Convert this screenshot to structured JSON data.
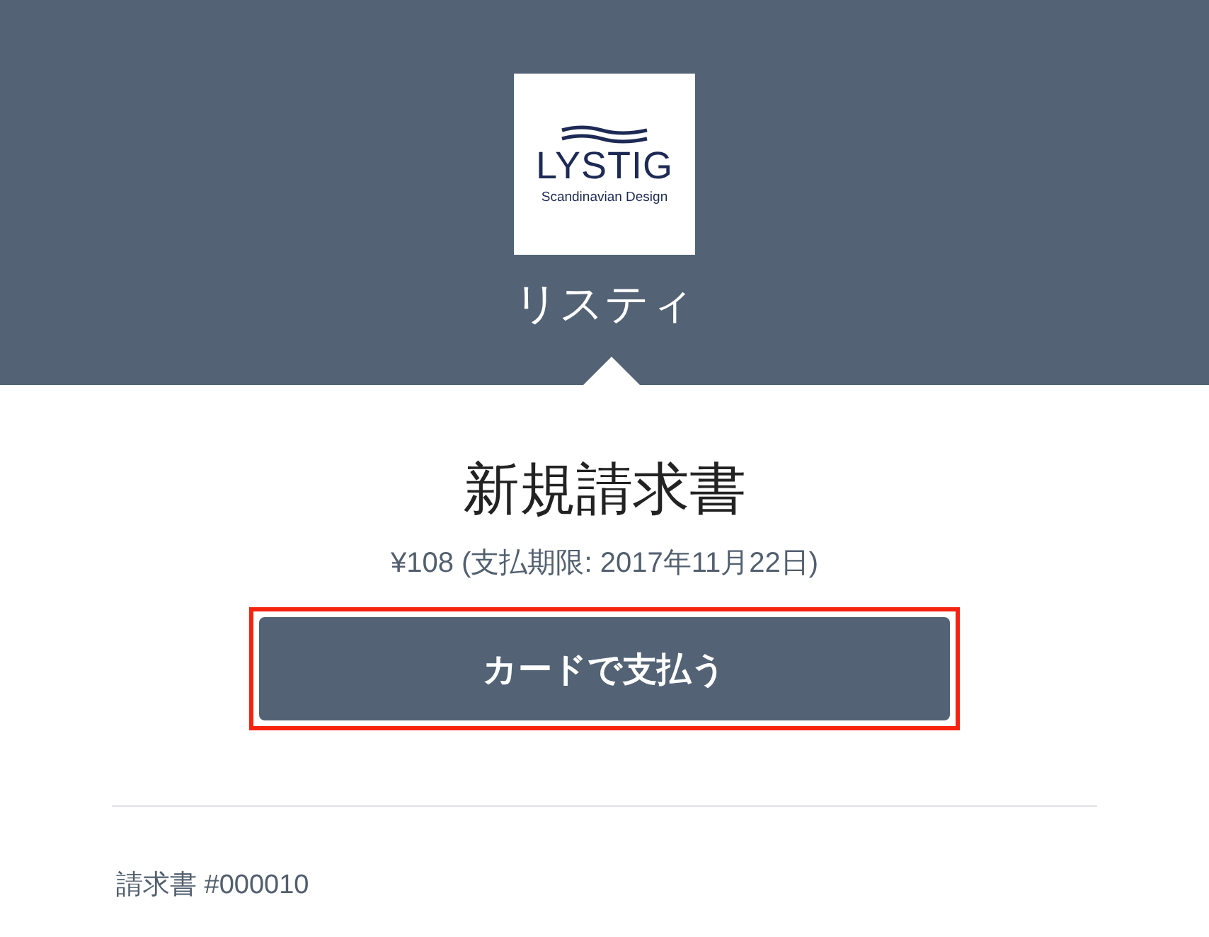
{
  "header": {
    "logo": {
      "brand": "LYSTIG",
      "tagline": "Scandinavian Design"
    },
    "store_name": "リスティ"
  },
  "invoice": {
    "title": "新規請求書",
    "amount_due": "¥108 (支払期限: 2017年11月22日)",
    "pay_button": {
      "label": "カードで支払う",
      "highlighted": true
    },
    "number": "請求書 #000010"
  }
}
